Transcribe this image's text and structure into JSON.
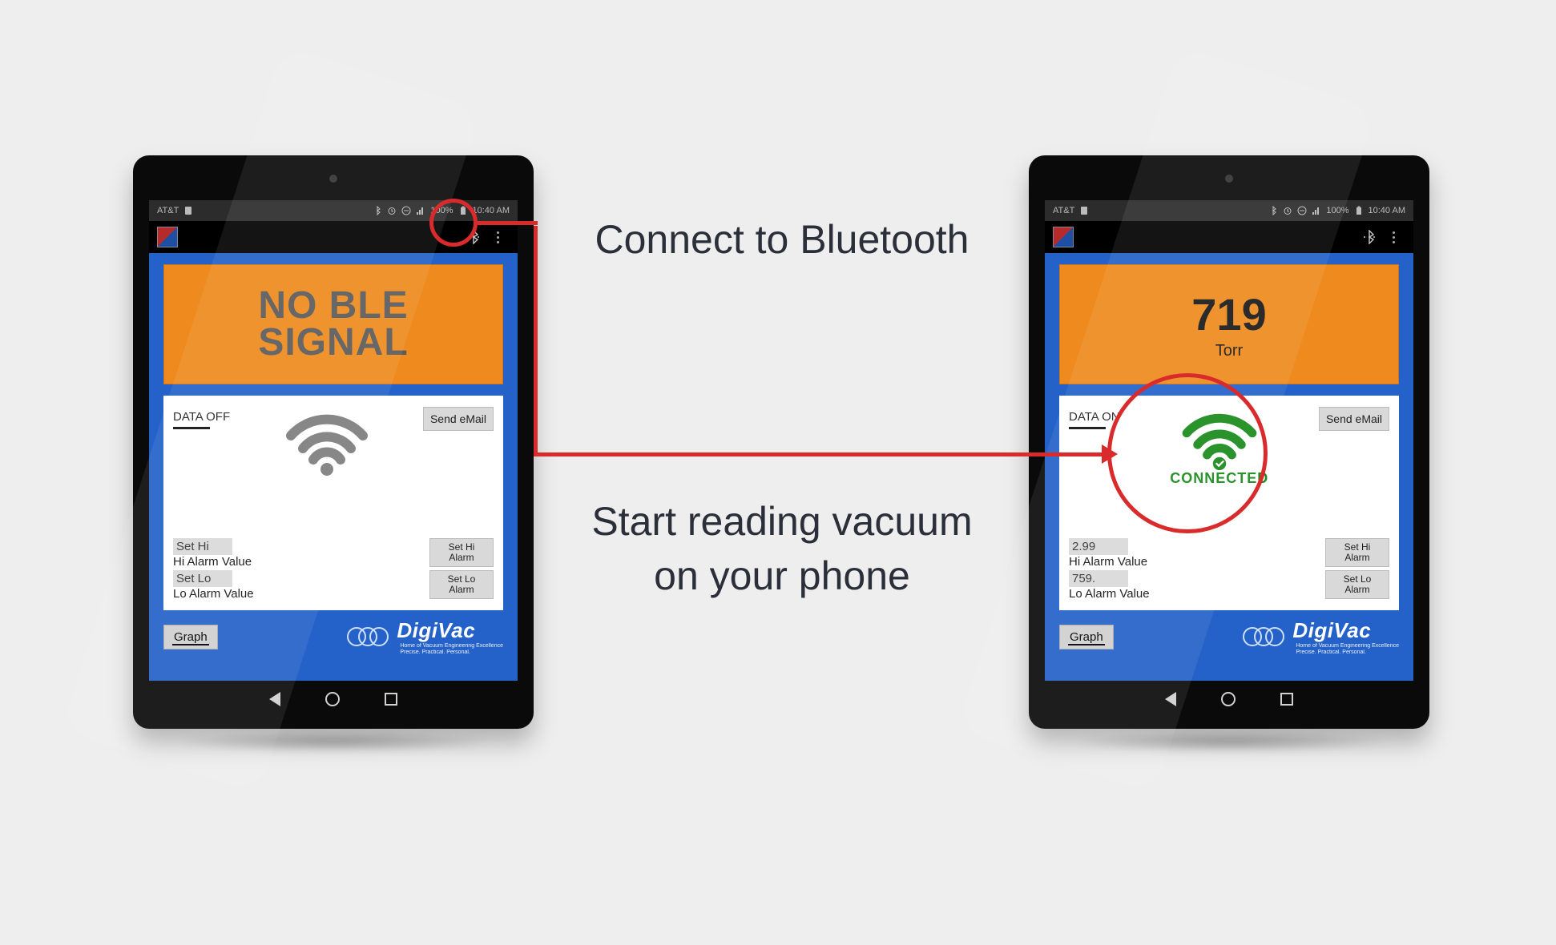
{
  "captions": {
    "top": "Connect to Bluetooth",
    "bottom": "Start reading vacuum on your phone"
  },
  "statusbar": {
    "carrier": "AT&T",
    "battery": "100%",
    "time": "10:40 AM"
  },
  "brand": {
    "name": "DigiVac",
    "tagline1": "Home of Vacuum Engineering Excellence",
    "tagline2": "Precise. Practical. Personal."
  },
  "common": {
    "send_email": "Send eMail",
    "set_hi_alarm": "Set Hi Alarm",
    "set_lo_alarm": "Set Lo Alarm",
    "hi_alarm_caption": "Hi Alarm Value",
    "lo_alarm_caption": "Lo Alarm Value",
    "graph": "Graph"
  },
  "left": {
    "display_line1": "NO BLE",
    "display_line2": "SIGNAL",
    "data_toggle": "DATA OFF",
    "hi_input": "Set Hi",
    "lo_input": "Set Lo"
  },
  "right": {
    "value": "719",
    "unit": "Torr",
    "data_toggle": "DATA ON",
    "connected": "CONNECTED",
    "hi_input": "2.99",
    "lo_input": "759."
  }
}
